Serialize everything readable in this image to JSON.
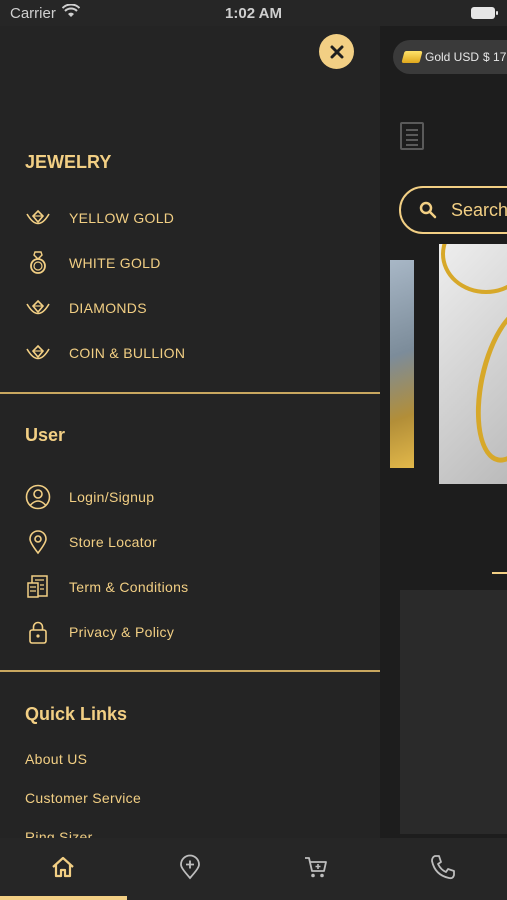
{
  "status_bar": {
    "carrier": "Carrier",
    "time": "1:02 AM"
  },
  "background": {
    "ticker": {
      "label": "Gold USD",
      "value": "$ 17"
    },
    "search_placeholder": "Search"
  },
  "drawer": {
    "jewelry": {
      "title": "JEWELRY",
      "items": [
        {
          "label": "YELLOW GOLD",
          "icon": "necklace-icon"
        },
        {
          "label": "WHITE GOLD",
          "icon": "ring-icon"
        },
        {
          "label": "DIAMONDS",
          "icon": "necklace-icon"
        },
        {
          "label": "COIN & BULLION",
          "icon": "necklace-icon"
        }
      ]
    },
    "user": {
      "title": "User",
      "items": [
        {
          "label": "Login/Signup",
          "icon": "user-icon"
        },
        {
          "label": "Store Locator",
          "icon": "location-pin-icon"
        },
        {
          "label": "Term & Conditions",
          "icon": "document-icon"
        },
        {
          "label": "Privacy & Policy",
          "icon": "lock-icon"
        }
      ]
    },
    "quick_links": {
      "title": "Quick Links",
      "items": [
        "About US",
        "Customer Service",
        "Ring Sizer"
      ]
    }
  },
  "tabbar": {
    "tabs": [
      {
        "icon": "home-icon"
      },
      {
        "icon": "add-location-icon"
      },
      {
        "icon": "cart-icon"
      },
      {
        "icon": "phone-icon"
      }
    ],
    "active_index": 0
  },
  "colors": {
    "accent": "#f2cf84",
    "drawer_bg": "#242424",
    "bar_bg": "#262626"
  }
}
